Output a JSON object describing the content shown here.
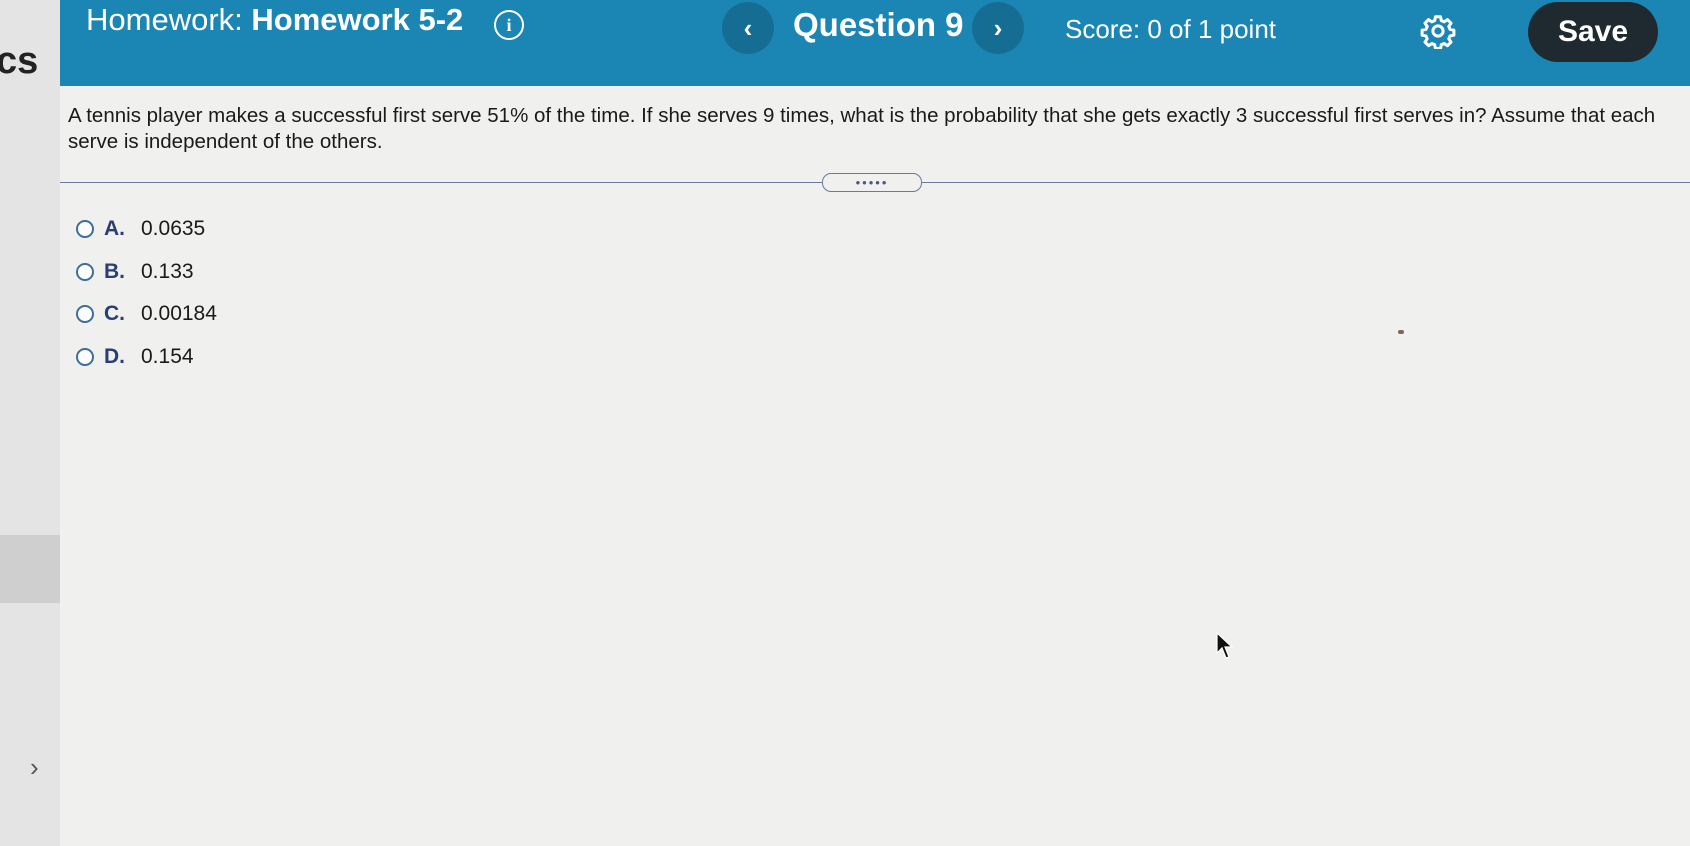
{
  "sidebar": {
    "brand_text": "cs",
    "expand_icon": "chevron-right-icon"
  },
  "header": {
    "title_prefix": "Homework:",
    "title_name": "Homework 5-2",
    "info_icon": "info-icon",
    "prev_icon": "chevron-left-icon",
    "question_label": "Question 9",
    "next_icon": "chevron-right-icon",
    "score": "Score: 0 of 1 point",
    "settings_icon": "gear-icon",
    "save_label": "Save",
    "background_color": "#1b86b4"
  },
  "question": {
    "text": "A tennis player makes a successful first serve 51% of the time. If she serves 9 times, what is the probability that she gets exactly 3 successful first serves in? Assume that each serve is independent of the others."
  },
  "answers": [
    {
      "letter": "A.",
      "value": "0.0635"
    },
    {
      "letter": "B.",
      "value": "0.133"
    },
    {
      "letter": "C.",
      "value": "0.00184"
    },
    {
      "letter": "D.",
      "value": "0.154"
    }
  ]
}
